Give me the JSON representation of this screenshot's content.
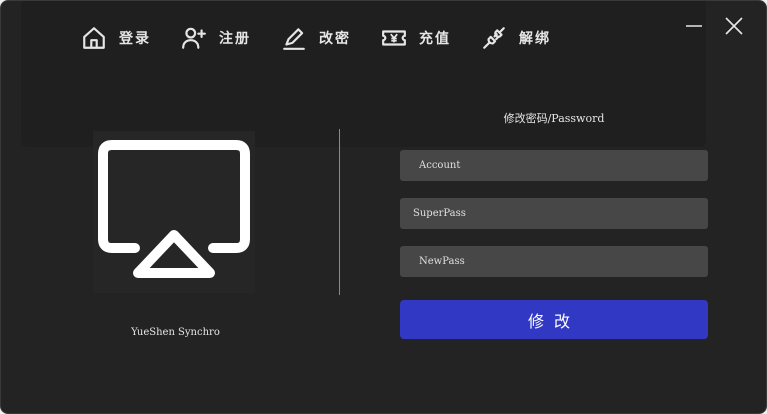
{
  "nav": {
    "items": [
      {
        "label": "登录",
        "icon": "home-icon"
      },
      {
        "label": "注册",
        "icon": "add-user-icon"
      },
      {
        "label": "改密",
        "icon": "pencil-icon"
      },
      {
        "label": "充值",
        "icon": "yuan-ticket-icon"
      },
      {
        "label": "解绑",
        "icon": "unplug-icon"
      }
    ]
  },
  "window_controls": {
    "minimize": "minimize-icon",
    "close": "close-icon"
  },
  "brand": {
    "app_name": "YueShen Synchro",
    "logo": "screen-cast-logo-icon"
  },
  "form": {
    "title": "修改密码/Password",
    "account_placeholder": "Account",
    "superpass_placeholder": "SuperPass",
    "newpass_placeholder": "NewPass",
    "submit_label": "修改"
  },
  "colors": {
    "background": "#232323",
    "field": "#474747",
    "accent": "#3138c3",
    "text": "#e6e6e6"
  }
}
